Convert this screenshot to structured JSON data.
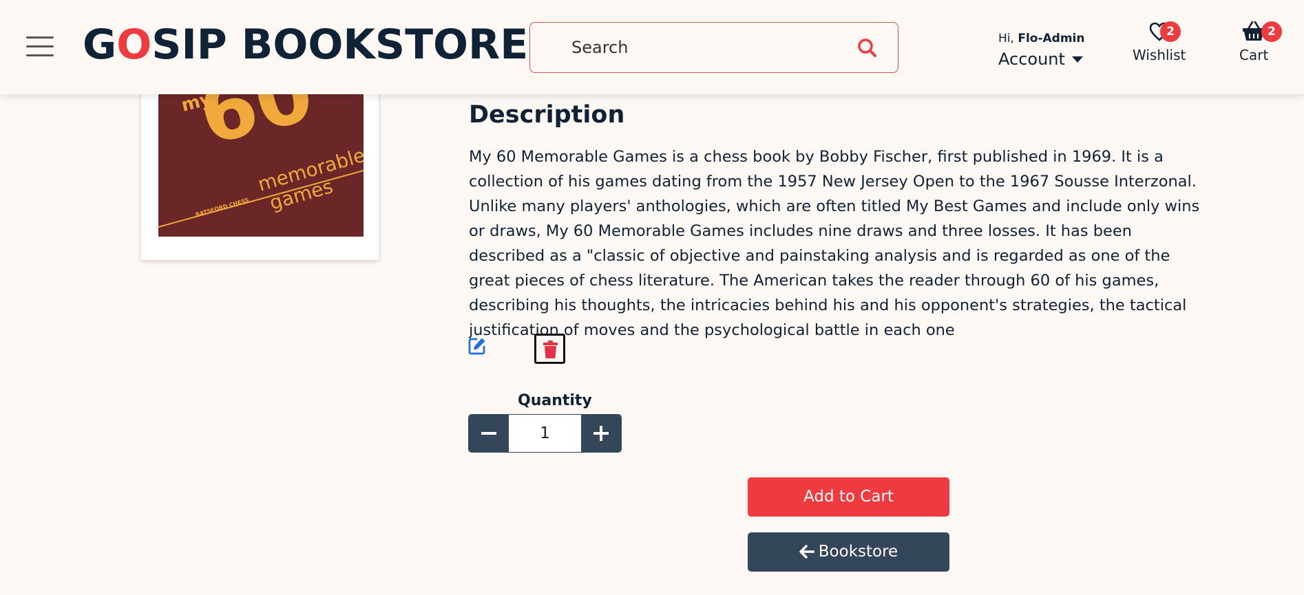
{
  "header": {
    "logo_first": "G",
    "logo_o": "O",
    "logo_rest": "SIP BOOKSTORE",
    "search_placeholder": "Search",
    "greeting_prefix": "Hi, ",
    "username": "Flo-Admin",
    "account_label": "Account",
    "wishlist_label": "Wishlist",
    "wishlist_count": "2",
    "cart_label": "Cart",
    "cart_count": "2"
  },
  "book": {
    "cover_text_my": "my",
    "cover_text_60": "60",
    "cover_text_memorable": "memorable",
    "cover_text_games": "games",
    "cover_text_publisher": "BATSFORD CHESS"
  },
  "description": {
    "title": "Description",
    "text": "My 60 Memorable Games is a chess book by Bobby Fischer, first published in 1969. It is a collection of his games dating from the 1957 New Jersey Open to the 1967 Sousse Interzonal. Unlike many players' anthologies, which are often titled My Best Games and include only wins or draws, My 60 Memorable Games includes nine draws and three losses. It has been described as a \"classic of objective and painstaking analysis and is regarded as one of the great pieces of chess literature. The American takes the reader through 60 of his games, describing his thoughts, the intricacies behind his and his opponent's strategies, the tactical justification of moves and the psychological battle in each one"
  },
  "quantity": {
    "label": "Quantity",
    "value": "1"
  },
  "actions": {
    "add_to_cart": "Add to Cart",
    "bookstore": "Bookstore"
  },
  "colors": {
    "accent_red": "#ef3b3f",
    "navy": "#0f2236",
    "slate": "#34475a",
    "background": "#fef8f4"
  },
  "icons": [
    "hamburger-icon",
    "search-icon",
    "heart-icon",
    "basket-icon",
    "edit-icon",
    "trash-icon",
    "minus-icon",
    "plus-icon",
    "arrow-left-icon"
  ]
}
